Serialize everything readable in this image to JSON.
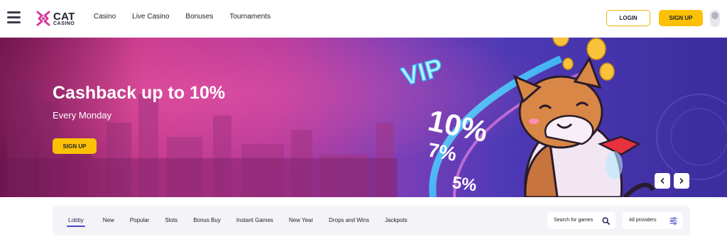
{
  "header": {
    "logo": {
      "line1": "CAT",
      "line2": "CASINO"
    },
    "nav": [
      "Casino",
      "Live Casino",
      "Bonuses",
      "Tournaments"
    ],
    "login_label": "LOGIN",
    "signup_label": "SIGN UP"
  },
  "banner": {
    "title": "Cashback up to 10%",
    "subtitle": "Every Monday",
    "button_label": "SIGN UP",
    "art_text": {
      "vip": "VIP",
      "p10": "10%",
      "p7": "7%",
      "p5": "5%"
    },
    "prev_icon": "chevron-left-icon",
    "next_icon": "chevron-right-icon"
  },
  "categories": {
    "tabs": [
      "Lobby",
      "New",
      "Popular",
      "Slots",
      "Bonus Buy",
      "Instant Games",
      "New Year",
      "Drops and Wins",
      "Jackpots"
    ],
    "active": "Lobby",
    "search_placeholder": "Search for games",
    "providers_label": "All providers"
  },
  "colors": {
    "accent_yellow": "#fcc105",
    "tab_underline": "#4a46c8",
    "brand_magenta": "#d63aa0"
  }
}
